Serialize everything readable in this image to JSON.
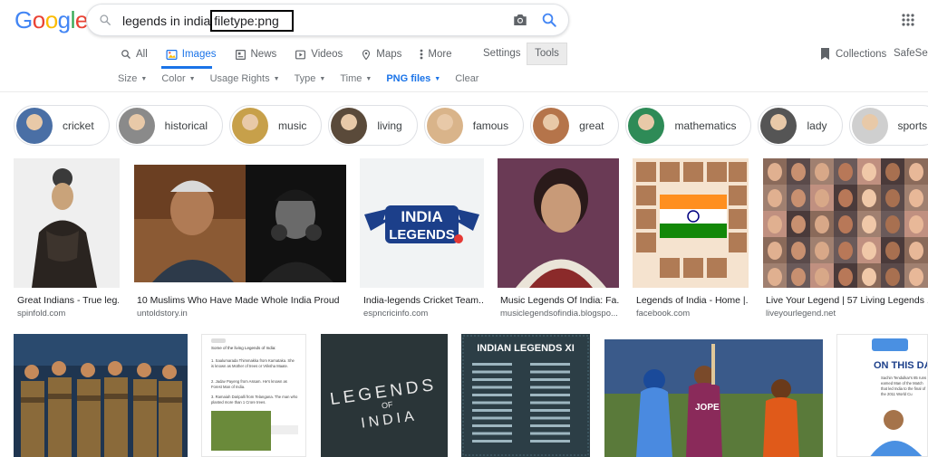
{
  "logo": {
    "letters": [
      "G",
      "o",
      "o",
      "g",
      "l",
      "e"
    ],
    "colors": [
      "#4285F4",
      "#EA4335",
      "#FBBC05",
      "#4285F4",
      "#34A853",
      "#EA4335"
    ]
  },
  "search": {
    "query_prefix": "legends in india ",
    "query_highlight": "filetype:png"
  },
  "tabs": [
    {
      "label": "All",
      "icon": "search-icon"
    },
    {
      "label": "Images",
      "icon": "image-icon",
      "active": true
    },
    {
      "label": "News",
      "icon": "news-icon"
    },
    {
      "label": "Videos",
      "icon": "video-icon"
    },
    {
      "label": "Maps",
      "icon": "map-pin-icon"
    },
    {
      "label": "More",
      "icon": "dots-vertical-icon"
    }
  ],
  "toolbar": {
    "settings": "Settings",
    "tools": "Tools",
    "collections": "Collections",
    "safesearch": "SafeSea"
  },
  "filters": [
    {
      "label": "Size"
    },
    {
      "label": "Color"
    },
    {
      "label": "Usage Rights"
    },
    {
      "label": "Type"
    },
    {
      "label": "Time"
    },
    {
      "label": "PNG files",
      "active": true
    },
    {
      "label": "Clear",
      "nocaret": true
    }
  ],
  "chips": [
    {
      "label": "cricket",
      "color": "#4a6fa5"
    },
    {
      "label": "historical",
      "color": "#8a8a8a"
    },
    {
      "label": "music",
      "color": "#c7a04a"
    },
    {
      "label": "living",
      "color": "#5a4a3a"
    },
    {
      "label": "famous",
      "color": "#d9b48a"
    },
    {
      "label": "great",
      "color": "#b5744a"
    },
    {
      "label": "mathematics",
      "color": "#2e8b57"
    },
    {
      "label": "lady",
      "color": "#555555"
    },
    {
      "label": "sports",
      "color": "#cfcfcf"
    }
  ],
  "results_row1": [
    {
      "title": "Great Indians - True leg...",
      "source": "spinfold.com"
    },
    {
      "title": "10 Muslims Who Have Made Whole India Proud",
      "source": "untoldstory.in"
    },
    {
      "title": "India-legends Cricket Team...",
      "source": "espncricinfo.com",
      "logo_top": "INDIA",
      "logo_bottom": "LEGENDS"
    },
    {
      "title": "Music Legends Of India: Fa...",
      "source": "musiclegendsofindia.blogspo..."
    },
    {
      "title": "Legends of India - Home |...",
      "source": "facebook.com"
    },
    {
      "title": "Live Your Legend | 57 Living Legends ...",
      "source": "liveyourlegend.net"
    }
  ],
  "results_row2": [
    {
      "kind": "team-photo"
    },
    {
      "kind": "document",
      "doc_heading": "Some of the living Legends of India:",
      "doc_items": [
        "1. Saalumarada Thimmakka from Karnataka. She is known as Mother of trees or Vriksha Maate.",
        "2. Jadav Payeng from Assam. He's known as Forest Man of India.",
        "3. Ramaiah Daripalli from Telangana. The man who planted more than 1 Crore trees."
      ]
    },
    {
      "kind": "poster",
      "line1": "LEGENDS",
      "line2": "OF",
      "line3": "INDIA"
    },
    {
      "kind": "team-list",
      "heading": "INDIAN LEGENDS XI"
    },
    {
      "kind": "cricket-action",
      "jersey_text": "JOPE"
    },
    {
      "kind": "promo",
      "banner": "ON THIS DAY",
      "text": "Sachin Tendulkar's 85 runs earned Man of the Match that led India to the final of the 2011 World Cu"
    }
  ]
}
